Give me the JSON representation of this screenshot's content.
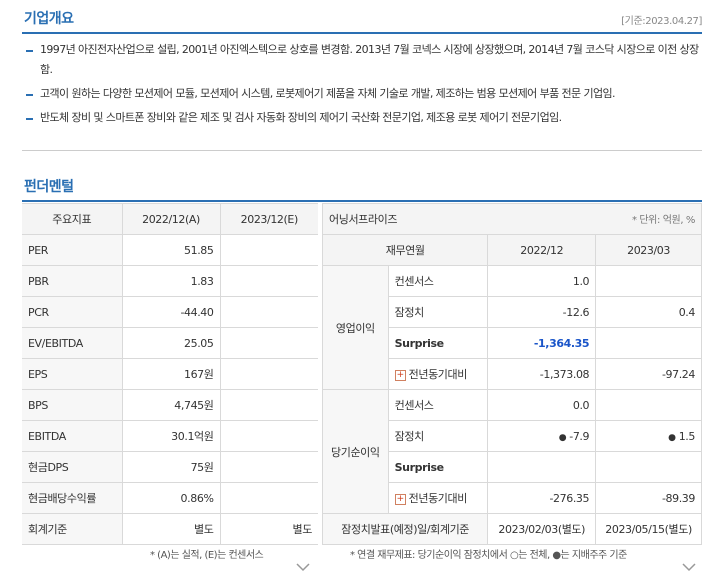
{
  "overview": {
    "title": "기업개요",
    "ref_date": "[기준:2023.04.27]",
    "items": [
      "1997년 아진전자산업으로 설립, 2001년 아진엑스텍으로 상호를 변경함. 2013년 7월 코넥스 시장에 상장했으며, 2014년 7월 코스닥 시장으로 이전 상장함.",
      "고객이 원하는 다양한 모션제어 모듈, 모션제어 시스템, 로봇제어기 제품을 자체 기술로 개발, 제조하는 범용 모션제어 부품 전문 기업임.",
      "반도체 장비 및 스마트폰 장비와 같은 제조 및 검사 자동화 장비의 제어기 국산화 전문기업, 제조용 로봇 제어기 전문기업임."
    ]
  },
  "fundamental": {
    "title": "펀더멘털",
    "headers": [
      "주요지표",
      "2022/12(A)",
      "2023/12(E)"
    ],
    "rows": [
      {
        "label": "PER",
        "v1": "51.85",
        "v2": ""
      },
      {
        "label": "PBR",
        "v1": "1.83",
        "v2": ""
      },
      {
        "label": "PCR",
        "v1": "-44.40",
        "v2": ""
      },
      {
        "label": "EV/EBITDA",
        "v1": "25.05",
        "v2": ""
      },
      {
        "label": "EPS",
        "v1": "167원",
        "v2": ""
      },
      {
        "label": "BPS",
        "v1": "4,745원",
        "v2": ""
      },
      {
        "label": "EBITDA",
        "v1": "30.1억원",
        "v2": ""
      },
      {
        "label": "현금DPS",
        "v1": "75원",
        "v2": ""
      },
      {
        "label": "현금배당수익률",
        "v1": "0.86%",
        "v2": ""
      },
      {
        "label": "회계기준",
        "v1": "별도",
        "v2": "별도"
      }
    ],
    "note": "* (A)는 실적, (E)는 컨센서스"
  },
  "earnings": {
    "title": "어닝서프라이즈",
    "unit": "* 단위: 억원, %",
    "headers": [
      "재무연월",
      "2022/12",
      "2023/03"
    ],
    "op_label": "영업이익",
    "op_rows": [
      {
        "label": "컨센서스",
        "v1": "1.0",
        "v2": ""
      },
      {
        "label": "잠정치",
        "v1": "-12.6",
        "v2": "0.4"
      },
      {
        "label": "Surprise",
        "v1": "-1,364.35",
        "v2": ""
      },
      {
        "label": "전년동기대비",
        "v1": "-1,373.08",
        "v2": "-97.24"
      }
    ],
    "ni_label": "당기순이익",
    "ni_rows": [
      {
        "label": "컨센서스",
        "v1": "0.0",
        "v2": ""
      },
      {
        "label": "잠정치",
        "v1": "-7.9",
        "v2": "1.5"
      },
      {
        "label": "Surprise",
        "v1": "",
        "v2": ""
      },
      {
        "label": "전년동기대비",
        "v1": "-276.35",
        "v2": "-89.39"
      }
    ],
    "announce_label": "잠정치발표(예정)일/회계기준",
    "announce_v1": "2023/02/03(별도)",
    "announce_v2": "2023/05/15(별도)",
    "note": "* 연결 재무제표: 당기순이익 잠정치에서 ○는 전체, ●는 지배주주 기준",
    "plus_symbol": "+",
    "open_dot": "○",
    "filled_dot": "●"
  },
  "colors": {
    "accent": "#2a6fb3",
    "surprise_negative": "#1a55c9"
  }
}
